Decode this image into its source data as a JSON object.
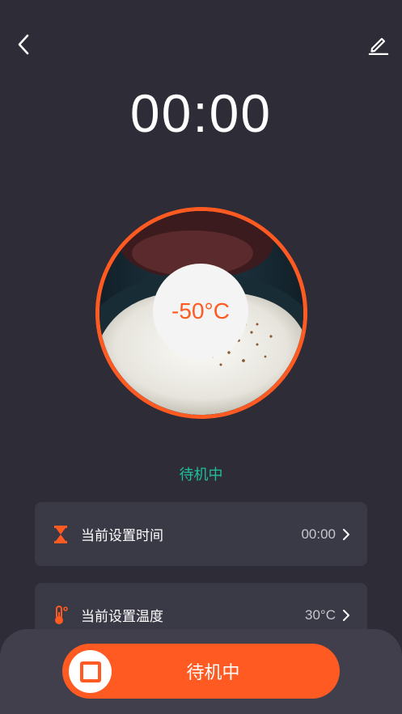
{
  "header": {
    "back_icon": "chevron-left-icon",
    "edit_icon": "pencil-icon"
  },
  "timer": {
    "display": "00:00"
  },
  "dish": {
    "temperature": "-50°C",
    "ring_color": "#ff5a22"
  },
  "status": {
    "label": "待机中",
    "color": "#1fbf9c"
  },
  "settings": [
    {
      "icon": "hourglass-icon",
      "label": "当前设置时间",
      "value": "00:00"
    },
    {
      "icon": "thermometer-icon",
      "label": "当前设置温度",
      "value": "30°C"
    }
  ],
  "action": {
    "label": "待机中",
    "icon": "stop-icon",
    "color": "#ff5a22"
  }
}
